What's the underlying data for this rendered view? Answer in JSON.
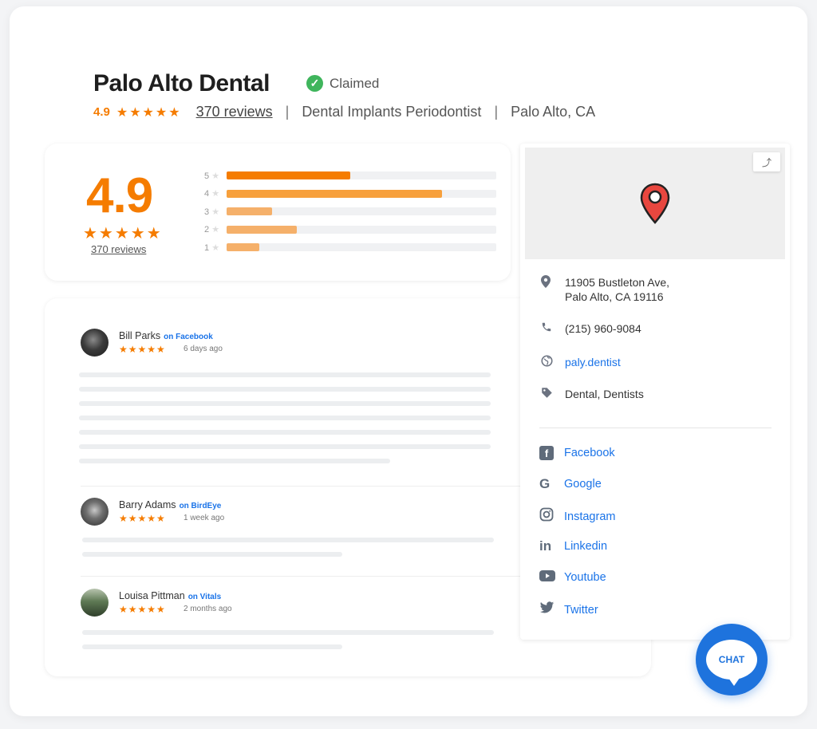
{
  "business": {
    "name": "Palo Alto Dental",
    "claimed_label": "Claimed",
    "rating": "4.9",
    "stars": "★★★★★",
    "reviews_link": "370 reviews",
    "separator": "|",
    "categories": "Dental Implants Periodontist",
    "location": "Palo Alto, CA"
  },
  "summary": {
    "rating": "4.9",
    "stars": "★★★★★",
    "reviews_link": "370 reviews",
    "distribution": [
      {
        "label": "5",
        "fraction": 0.46
      },
      {
        "label": "4",
        "fraction": 0.8
      },
      {
        "label": "3",
        "fraction": 0.17
      },
      {
        "label": "2",
        "fraction": 0.26
      },
      {
        "label": "1",
        "fraction": 0.12
      }
    ],
    "colors": {
      "bar_primary": "#f57c00",
      "bar_secondary": "#f7a03c",
      "bar_light": "#f5b06a"
    }
  },
  "reviews": [
    {
      "name": "Bill Parks",
      "source": "on Facebook",
      "stars": "★★★★★",
      "time": "6 days ago"
    },
    {
      "name": "Barry Adams",
      "source": "on BirdEye",
      "stars": "★★★★★",
      "time": "1 week ago"
    },
    {
      "name": "Louisa Pittman",
      "source": "on Vitals",
      "stars": "★★★★★",
      "time": "2 months ago"
    }
  ],
  "contact": {
    "address_line1": "11905 Bustleton Ave,",
    "address_line2": "Palo Alto, CA 19116",
    "phone": "(215) 960-9084",
    "website": "paly.dentist",
    "tags": "Dental, Dentists"
  },
  "social": [
    {
      "label": "Facebook",
      "icon": "facebook-icon"
    },
    {
      "label": "Google",
      "icon": "google-icon"
    },
    {
      "label": "Instagram",
      "icon": "instagram-icon"
    },
    {
      "label": "Linkedin",
      "icon": "linkedin-icon"
    },
    {
      "label": "Youtube",
      "icon": "youtube-icon"
    },
    {
      "label": "Twitter",
      "icon": "twitter-icon"
    }
  ],
  "chat": {
    "label": "CHAT"
  },
  "colors": {
    "accent": "#f57c00",
    "link": "#1a73e8",
    "chat": "#1e73dd",
    "claimed": "#3fb55c"
  }
}
